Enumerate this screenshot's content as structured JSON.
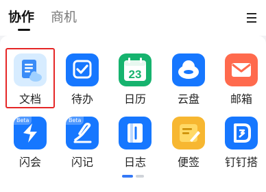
{
  "tabs": [
    {
      "label": "协作",
      "active": true
    },
    {
      "label": "商机",
      "active": false
    }
  ],
  "menu": {
    "icon": "hamburger-icon"
  },
  "apps": [
    {
      "label": "文档",
      "icon": "document-cloud-icon",
      "color": "#d7ecff",
      "highlighted": true
    },
    {
      "label": "待办",
      "icon": "todo-check-icon",
      "color": "#1677ff"
    },
    {
      "label": "日历",
      "icon": "calendar-icon",
      "color": "#16b36e",
      "badge": "23"
    },
    {
      "label": "云盘",
      "icon": "cloud-drive-icon",
      "color": "#1677ff"
    },
    {
      "label": "邮箱",
      "icon": "mail-icon",
      "color": "#ff6a4d"
    },
    {
      "label": "闪会",
      "icon": "flash-meeting-icon",
      "color": "#1677ff",
      "tag": "Beta"
    },
    {
      "label": "闪记",
      "icon": "flash-note-icon",
      "color": "#1677ff",
      "tag": "Beta"
    },
    {
      "label": "日志",
      "icon": "journal-icon",
      "color": "#1677ff"
    },
    {
      "label": "便签",
      "icon": "sticky-note-icon",
      "color": "#f7b731"
    },
    {
      "label": "钉钉搭",
      "icon": "dingtalk-builder-icon",
      "color": "#1677ff"
    }
  ],
  "pager": {
    "pages": 2,
    "current": 1
  }
}
